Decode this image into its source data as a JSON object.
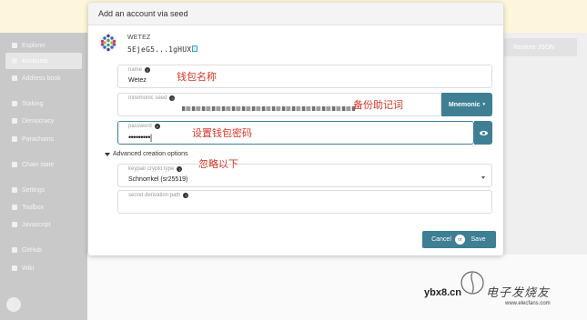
{
  "sidebar": {
    "items": [
      {
        "label": "Explorer"
      },
      {
        "label": "Accounts"
      },
      {
        "label": "Address book"
      },
      {
        "label": "Staking"
      },
      {
        "label": "Democracy"
      },
      {
        "label": "Parachains"
      },
      {
        "label": "Chain state"
      },
      {
        "label": "Settings"
      },
      {
        "label": "Toolbox"
      },
      {
        "label": "Javascript"
      },
      {
        "label": "GitHub"
      },
      {
        "label": "Wiki"
      }
    ]
  },
  "background": {
    "restore_label": "Restore JSON"
  },
  "modal": {
    "title": "Add an account via seed",
    "account_name": "WETEZ",
    "account_address": "5EjeG5...1gHUXb",
    "name_field": {
      "label": "name",
      "value": "Wetez"
    },
    "seed_field": {
      "label": "mnemonic seed"
    },
    "seed_type_button": "Mnemonic",
    "password_field": {
      "label": "password",
      "value": "•••••••••|"
    },
    "advanced_toggle": "Advanced creation options",
    "keypair_field": {
      "label": "keypair crypto type",
      "value": "Schnorrkel (sr25519)"
    },
    "derivation_field": {
      "label": "secret derivation path"
    },
    "cancel_label": "Cancel",
    "or_label": "or",
    "save_label": "Save"
  },
  "annotations": {
    "wallet_name": "钱包名称",
    "backup_mnemonic": "备份助记词",
    "set_password": "设置钱包密码",
    "ignore_below": "忽略以下"
  },
  "watermark": {
    "site": "ybx8.cn",
    "brand": "电子发烧友",
    "url": "www.elecfans.com"
  },
  "colors": {
    "accent": "#3e7f93",
    "annotation": "#d2392b",
    "banner": "#fdf6dc"
  }
}
